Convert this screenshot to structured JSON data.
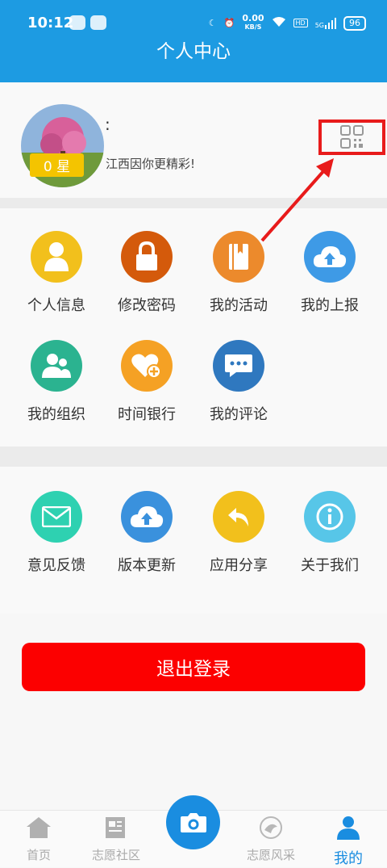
{
  "status_bar": {
    "time": "10:12",
    "net_speed": "0.00",
    "net_unit": "KB/S",
    "hd": "HD",
    "signal": "5G",
    "battery": "96"
  },
  "header": {
    "title": "个人中心"
  },
  "profile": {
    "name": ":",
    "stars": "0 星",
    "slogan": "江西因你更精彩!"
  },
  "grid_main": [
    {
      "label": "个人信息",
      "icon": "person-icon",
      "color": "#f2c01c"
    },
    {
      "label": "修改密码",
      "icon": "lock-icon",
      "color": "#d45a0b"
    },
    {
      "label": "我的活动",
      "icon": "book-icon",
      "color": "#ec8a2c"
    },
    {
      "label": "我的上报",
      "icon": "cloud-upload-icon",
      "color": "#3e9ae6"
    },
    {
      "label": "我的组织",
      "icon": "group-icon",
      "color": "#2bb390"
    },
    {
      "label": "时间银行",
      "icon": "heart-plus-icon",
      "color": "#f5a124"
    },
    {
      "label": "我的评论",
      "icon": "chat-icon",
      "color": "#2f78bf"
    }
  ],
  "grid_more": [
    {
      "label": "意见反馈",
      "icon": "mail-icon",
      "color": "#2ed1b1"
    },
    {
      "label": "版本更新",
      "icon": "cloud-update-icon",
      "color": "#3a91dd"
    },
    {
      "label": "应用分享",
      "icon": "share-icon",
      "color": "#f2c01c"
    },
    {
      "label": "关于我们",
      "icon": "info-icon",
      "color": "#57c6e8"
    }
  ],
  "logout_label": "退出登录",
  "tabs": [
    {
      "label": "首页",
      "icon": "home-icon"
    },
    {
      "label": "志愿社区",
      "icon": "newspaper-icon"
    },
    {
      "label": "志愿风采",
      "icon": "emblem-icon"
    },
    {
      "label": "我的",
      "icon": "user-icon"
    }
  ],
  "colors": {
    "brand": "#1d9be2",
    "accent": "#1a8de0",
    "logout": "#fc0000",
    "annotation": "#e81b1b"
  }
}
